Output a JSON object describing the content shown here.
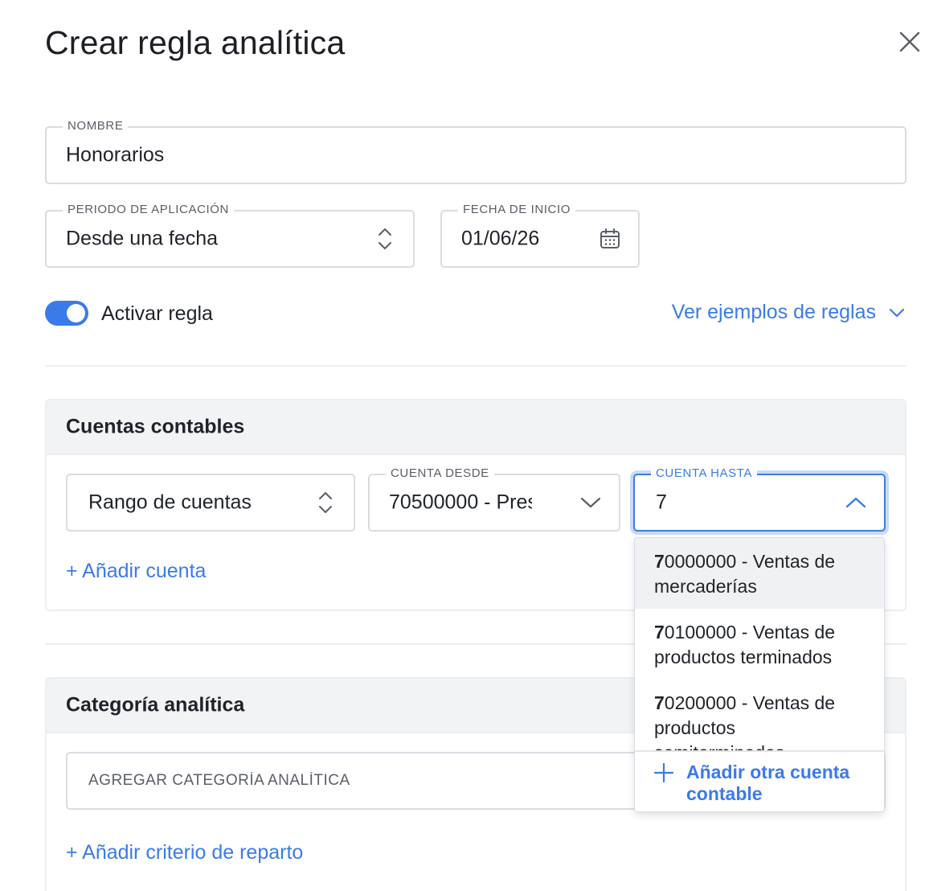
{
  "dialog": {
    "title": "Crear regla analítica"
  },
  "form": {
    "nombre": {
      "label": "NOMBRE",
      "value": "Honorarios"
    },
    "periodo": {
      "label": "PERIODO DE APLICACIÓN",
      "value": "Desde una fecha"
    },
    "fecha_inicio": {
      "label": "FECHA DE INICIO",
      "value": "01/06/26"
    },
    "activar": {
      "label": "Activar regla",
      "checked": true
    },
    "examples_link": "Ver ejemplos de reglas"
  },
  "cuentas": {
    "title": "Cuentas contables",
    "tipo": {
      "value": "Rango de cuentas"
    },
    "desde": {
      "label": "CUENTA DESDE",
      "value": "70500000 - Pres"
    },
    "hasta": {
      "label": "CUENTA HASTA",
      "value": "7"
    },
    "add_link": "+ Añadir cuenta",
    "dropdown": {
      "items": [
        {
          "match": "7",
          "rest_line1": "0000000 - Ventas de",
          "line2": "mercaderías"
        },
        {
          "match": "7",
          "rest_line1": "0100000 - Ventas de",
          "line2": "productos terminados"
        },
        {
          "match": "7",
          "rest_line1": "0200000 - Ventas de",
          "line2": "productos",
          "line3": "semiterminados"
        }
      ],
      "footer": "Añadir otra cuenta contable"
    }
  },
  "categoria": {
    "title": "Categoría analítica",
    "add_placeholder": "AGREGAR CATEGORÍA ANALÍTICA",
    "add_link": "+ Añadir criterio de reparto"
  },
  "colors": {
    "accent": "#3b7be8",
    "border": "#d9dde2",
    "header_bg": "#f2f3f5"
  }
}
